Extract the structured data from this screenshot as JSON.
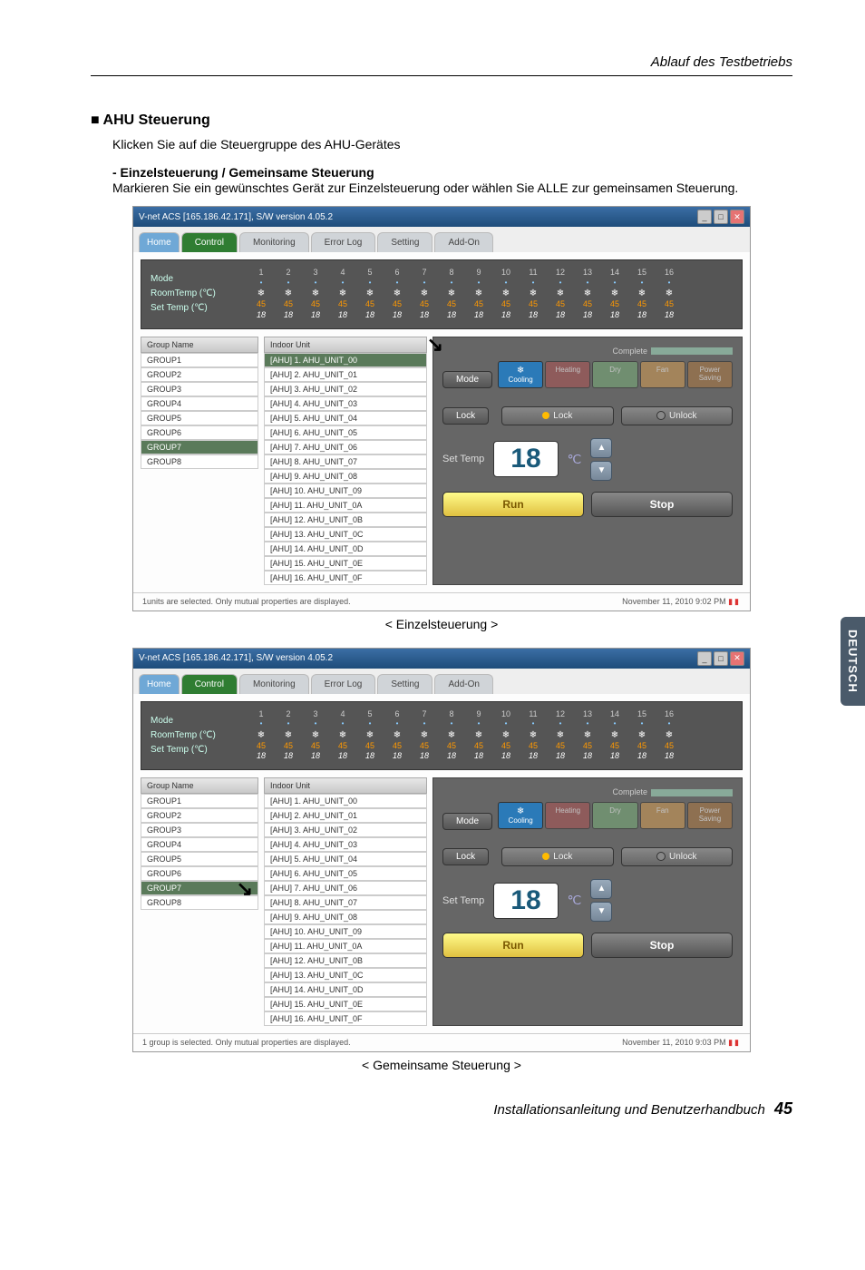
{
  "header": {
    "running": "Ablauf des Testbetriebs"
  },
  "section": {
    "title": "■ AHU Steuerung",
    "intro": "Klicken Sie auf die Steuergruppe des AHU-Gerätes",
    "subTitle": "- Einzelsteuerung / Gemeinsame Steuerung",
    "subBody": "Markieren Sie ein gewünschtes Gerät zur Einzelsteuerung oder wählen Sie ALLE zur gemeinsamen Steuerung."
  },
  "app": {
    "title": "V-net ACS [165.186.42.171],   S/W version 4.05.2",
    "tabs": {
      "home": "Home",
      "control": "Control",
      "monitoring": "Monitoring",
      "errorlog": "Error Log",
      "setting": "Setting",
      "addon": "Add-On"
    },
    "overview": {
      "labels": {
        "mode": "Mode",
        "room": "RoomTemp (℃)",
        "set": "Set Temp  (℃)"
      },
      "colNums": [
        "1",
        "2",
        "3",
        "4",
        "5",
        "6",
        "7",
        "8",
        "9",
        "10",
        "11",
        "12",
        "13",
        "14",
        "15",
        "16"
      ],
      "t1": "45",
      "t2": "18"
    },
    "headers": {
      "group": "Group Name",
      "indoor": "Indoor Unit",
      "complete": "Complete"
    },
    "groups": [
      "GROUP1",
      "GROUP2",
      "GROUP3",
      "GROUP4",
      "GROUP5",
      "GROUP6",
      "GROUP7",
      "GROUP8"
    ],
    "units": [
      "[AHU]  1. AHU_UNIT_00",
      "[AHU]  2. AHU_UNIT_01",
      "[AHU]  3. AHU_UNIT_02",
      "[AHU]  4. AHU_UNIT_03",
      "[AHU]  5. AHU_UNIT_04",
      "[AHU]  6. AHU_UNIT_05",
      "[AHU]  7. AHU_UNIT_06",
      "[AHU]  8. AHU_UNIT_07",
      "[AHU]  9. AHU_UNIT_08",
      "[AHU] 10. AHU_UNIT_09",
      "[AHU] 11. AHU_UNIT_0A",
      "[AHU] 12. AHU_UNIT_0B",
      "[AHU] 13. AHU_UNIT_0C",
      "[AHU] 14. AHU_UNIT_0D",
      "[AHU] 15. AHU_UNIT_0E",
      "[AHU] 16. AHU_UNIT_0F"
    ],
    "ctrl": {
      "mode": "Mode",
      "cooling": "Cooling",
      "heating": "Heating",
      "dry": "Dry",
      "fan": "Fan",
      "power": "Power Saving",
      "lock": "Lock",
      "lockBtn": "Lock",
      "unlockBtn": "Unlock",
      "setTemp": "Set Temp",
      "tempVal": "18",
      "deg": "℃",
      "run": "Run",
      "stop": "Stop"
    },
    "status1": {
      "left": "1units are selected. Only mutual properties are displayed.",
      "right": "November 11, 2010  9:02 PM"
    },
    "status2": {
      "left": "1 group is selected. Only mutual properties are displayed.",
      "right": "November 11, 2010  9:03 PM"
    }
  },
  "captions": {
    "single": "< Einzelsteuerung >",
    "group": "< Gemeinsame Steuerung >"
  },
  "sideTab": "DEUTSCH",
  "footer": {
    "text": "Installationsanleitung und Benutzerhandbuch",
    "page": "45"
  }
}
